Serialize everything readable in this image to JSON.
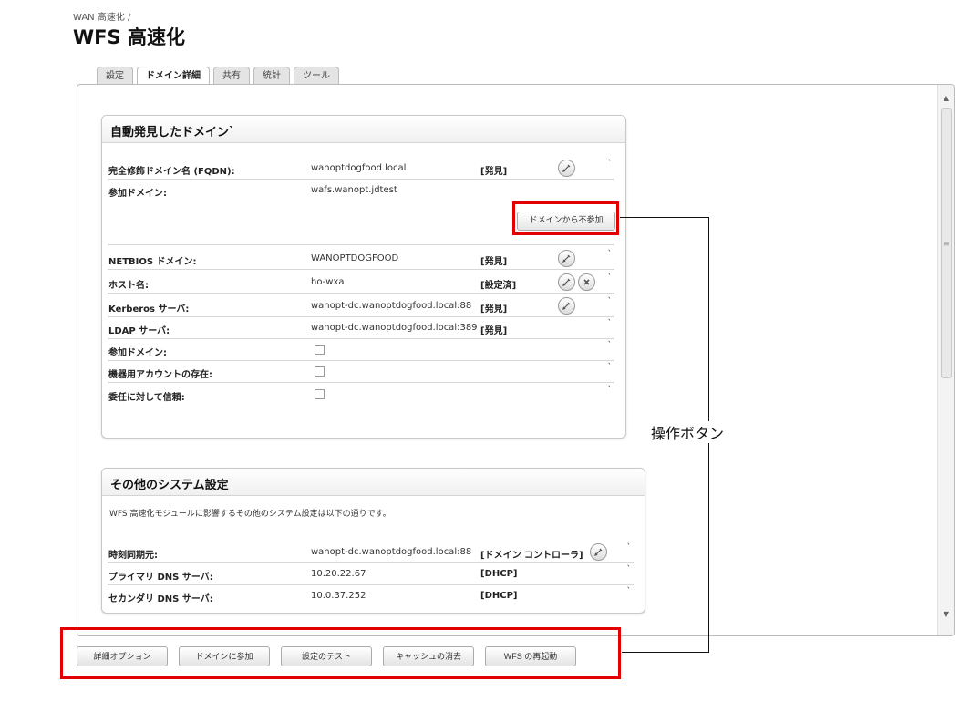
{
  "breadcrumb": "WAN 高速化 /",
  "page_title": "WFS 高速化",
  "tabs": [
    {
      "label": "設定",
      "active": false
    },
    {
      "label": "ドメイン詳細",
      "active": true
    },
    {
      "label": "共有",
      "active": false
    },
    {
      "label": "統計",
      "active": false
    },
    {
      "label": "ツール",
      "active": false
    }
  ],
  "auto_domain": {
    "title": "自動発見したドメイン",
    "title_mark": "ˋ",
    "rows": [
      {
        "label": "完全修飾ドメイン名 (FQDN):",
        "value": "wanoptdogfood.local",
        "status": "[発見]"
      },
      {
        "label": "参加ドメイン:",
        "value": "wafs.wanopt.jdtest",
        "status": ""
      },
      {
        "label": "NETBIOS ドメイン:",
        "value": "WANOPTDOGFOOD",
        "status": "[発見]"
      },
      {
        "label": "ホスト名:",
        "value": "ho-wxa",
        "status": "[設定済]"
      },
      {
        "label": "Kerberos サーバ:",
        "value": "wanopt-dc.wanoptdogfood.local:88",
        "status": "[発見]"
      },
      {
        "label": "LDAP サーバ:",
        "value": "wanopt-dc.wanoptdogfood.local:389",
        "status": "[発見]"
      },
      {
        "label": "参加ドメイン:",
        "value": "",
        "status": ""
      },
      {
        "label": "機器用アカウントの存在:",
        "value": "",
        "status": ""
      },
      {
        "label": "委任に対して信頼:",
        "value": "",
        "status": ""
      }
    ],
    "unjoin_button": "ドメインから不参加"
  },
  "other_settings": {
    "title": "その他のシステム設定",
    "description": "WFS 高速化モジュールに影響するその他のシステム設定は以下の通りです。",
    "rows": [
      {
        "label": "時刻同期元:",
        "value": "wanopt-dc.wanoptdogfood.local:88",
        "status": "[ドメイン コントローラ]"
      },
      {
        "label": "プライマリ DNS サーバ:",
        "value": "10.20.22.67",
        "status": "[DHCP]"
      },
      {
        "label": "セカンダリ DNS サーバ:",
        "value": "10.0.37.252",
        "status": "[DHCP]"
      }
    ]
  },
  "footer_buttons": [
    "詳細オプション",
    "ドメインに参加",
    "設定のテスト",
    "キャッシュの消去",
    "WFS の再起動"
  ],
  "row_tick": "ˋ",
  "scrollbar": {
    "up": "▲",
    "down": "▼",
    "grip": "≡"
  },
  "callout_label": "操作ボタン",
  "colors": {
    "highlight": "#e30000",
    "section_border": "#c8c8c8",
    "tab_inactive": "#e4e4e4"
  }
}
